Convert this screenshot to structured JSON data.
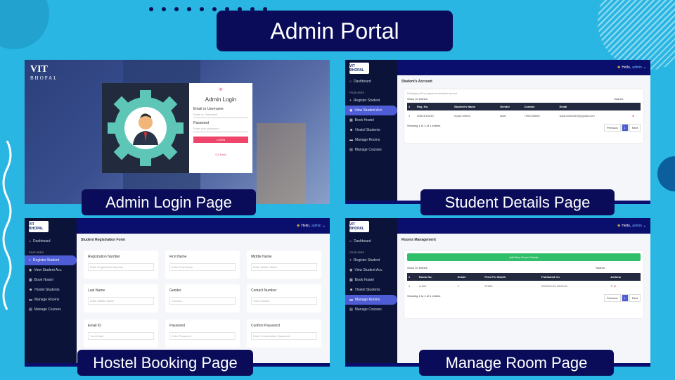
{
  "title": "Admin Portal",
  "captions": {
    "login": "Admin Login Page",
    "student": "Student Details Page",
    "hostel": "Hostel Booking Page",
    "rooms": "Manage Room Page"
  },
  "login": {
    "logo_main": "VIT",
    "logo_sub": "BHOPAL",
    "card_title": "Admin Login",
    "user_label": "Email or Username",
    "user_placeholder": "Email or Username",
    "pass_label": "Password",
    "pass_placeholder": "Enter your password",
    "button": "LOGIN",
    "back": "Go Back"
  },
  "dash": {
    "logo": "VIT BHOPAL",
    "greeting": "Hello,",
    "user": "admin",
    "menu": [
      "Dashboard",
      "FEATURES",
      "Register Student",
      "View Student Acc.",
      "Book Hostel",
      "Hostel Students",
      "Manage Rooms",
      "Manage Courses"
    ]
  },
  "student": {
    "heading": "Student's Account",
    "note": "Displaying all the registered student's account",
    "show": "Show",
    "entries_val": "10",
    "entries": "entries",
    "search": "Search:",
    "columns": [
      "#",
      "Reg. No.",
      "Student's Name",
      "Gender",
      "Contact",
      "Email"
    ],
    "rows": [
      [
        "1",
        "20BCE10040",
        "Aryan Mehta",
        "Male",
        "7903333650",
        "aryanmehta310@gmail.com"
      ]
    ],
    "footer": "Showing 1 to 1 of 1 entries",
    "prev": "Previous",
    "page": "1",
    "next": "Next"
  },
  "hostel": {
    "heading": "Student Registration Form",
    "fields": [
      {
        "label": "Registration Number",
        "ph": "Enter Registration Number"
      },
      {
        "label": "First Name",
        "ph": "Enter First Name"
      },
      {
        "label": "Middle Name",
        "ph": "Enter Middle Name"
      },
      {
        "label": "Last Name",
        "ph": "Enter Middle Name"
      },
      {
        "label": "Gender",
        "ph": "Choose..."
      },
      {
        "label": "Contact Number",
        "ph": "Your Contact"
      },
      {
        "label": "Email ID",
        "ph": "Your Email"
      },
      {
        "label": "Password",
        "ph": "Enter Password"
      },
      {
        "label": "Confirm Password",
        "ph": "Enter Confirmation Password"
      }
    ]
  },
  "rooms": {
    "heading": "Rooms Management",
    "add": "Add New Room Details",
    "show": "Show",
    "entries_val": "10",
    "entries": "entries",
    "search": "Search:",
    "columns": [
      "#",
      "Room No.",
      "Seater",
      "Fees Per Month",
      "Published On",
      "Actions"
    ],
    "rows": [
      [
        "1",
        "A-001",
        "2",
        "37000",
        "2023-02-20 23:29:51"
      ]
    ],
    "footer": "Showing 1 to 1 of 1 entries",
    "prev": "Previous",
    "page": "1",
    "next": "Next",
    "url": "localhost/hms/admin/add-rooms.php"
  }
}
